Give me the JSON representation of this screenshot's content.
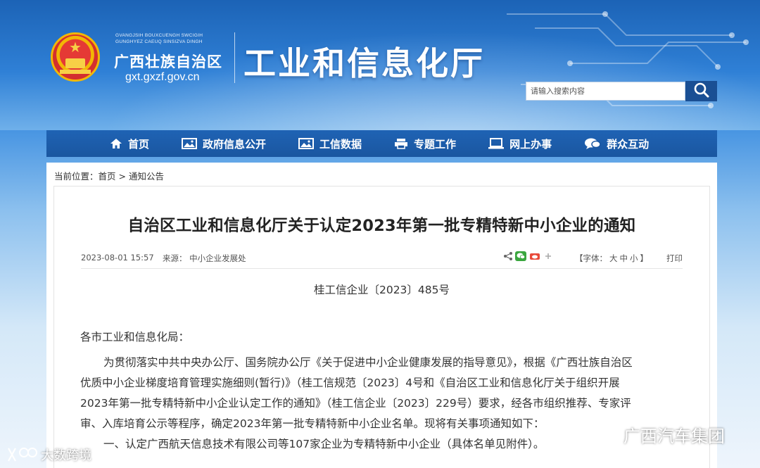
{
  "header": {
    "latin_line1": "GVANGJSIH BOUXCUENGH SWCIGIH",
    "latin_line2": "GUNGHYEZ CAEUQ SINSIZVA DINGH",
    "region_name": "广西壮族自治区",
    "domain": "gxt.gxzf.gov.cn",
    "dept_name": "工业和信息化厅",
    "search_placeholder": "请输入搜索内容"
  },
  "nav": {
    "items": [
      {
        "label": "首页",
        "icon": "home-icon"
      },
      {
        "label": "政府信息公开",
        "icon": "picture-icon"
      },
      {
        "label": "工信数据",
        "icon": "picture-icon"
      },
      {
        "label": "专题工作",
        "icon": "printer-icon"
      },
      {
        "label": "网上办事",
        "icon": "laptop-icon"
      },
      {
        "label": "群众互动",
        "icon": "chat-icon"
      }
    ]
  },
  "breadcrumb": {
    "prefix": "当前位置：",
    "home": "首页",
    "sep": " > ",
    "current": "通知公告"
  },
  "article": {
    "title": "自治区工业和信息化厅关于认定2023年第一批专精特新中小企业的通知",
    "date": "2023-08-01 15:57",
    "source": "来源：  中小企业发展处",
    "fontsize_label": "【字体：",
    "font_large": "大",
    "font_medium": "中",
    "font_small": "小",
    "fontsize_end": "】",
    "print": "打印",
    "doc_number": "桂工信企业〔2023〕485号",
    "salutation": "各市工业和信息化局：",
    "para1_line1": "为贯彻落实中共中央办公厅、国务院办公厅《关于促进中小企业健康发展的指导意见》，根据《广西壮族自治区",
    "para1_line2": "优质中小企业梯度培育管理实施细则(暂行)》（桂工信规范〔2023〕4号和《自治区工业和信息化厅关于组织开展",
    "para1_line3": "2023年第一批专精特新中小企业认定工作的通知》（桂工信企业〔2023〕229号）要求，经各市组织推荐、专家评",
    "para1_line4": "审、入库培育公示等程序，确定2023年第一批专精特新中小企业名单。现将有关事项通知如下：",
    "para2": "一、认定广西航天信息技术有限公司等107家企业为专精特新中小企业（具体名单见附件）。"
  },
  "watermarks": {
    "right": "广西汽车集团",
    "left": "大数跨境"
  },
  "colors": {
    "nav_bg": "#1a56a0",
    "search_btn": "#1a4f94"
  }
}
